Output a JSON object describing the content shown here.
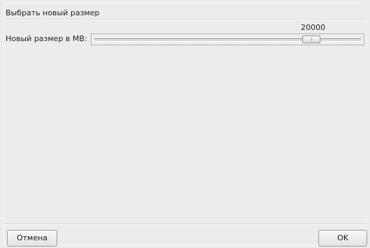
{
  "dialog": {
    "title": "Выбрать новый размер"
  },
  "resize": {
    "label": "Новый размер в MB:",
    "value": "20000",
    "slider_fraction": 0.83
  },
  "buttons": {
    "cancel_label": "Отмена",
    "ok_label": "OK"
  }
}
